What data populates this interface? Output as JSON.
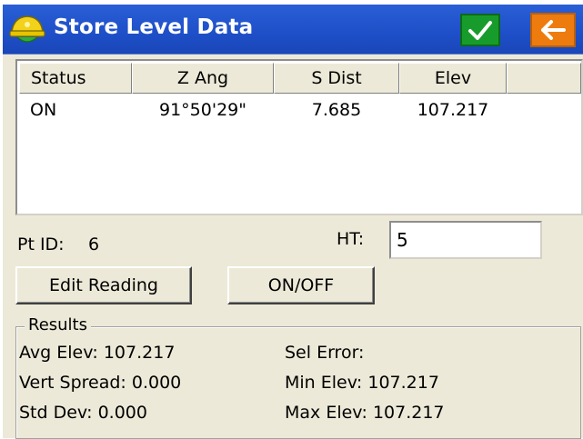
{
  "window": {
    "title": "Store Level Data"
  },
  "titlebar_icons": {
    "app": "hardhat-icon",
    "ok": "checkmark-icon",
    "back": "arrow-left-icon",
    "ok_color": "#179c2b",
    "back_color": "#ee7b0d"
  },
  "table": {
    "columns": [
      "Status",
      "Z Ang",
      "S Dist",
      "Elev",
      ""
    ],
    "rows": [
      [
        "ON",
        "91°50'29\"",
        "7.685",
        "107.217"
      ]
    ]
  },
  "point": {
    "label": "Pt ID:",
    "value": "6"
  },
  "ht": {
    "label": "HT:",
    "value": "5"
  },
  "buttons": {
    "edit_reading": "Edit Reading",
    "on_off": "ON/OFF"
  },
  "results": {
    "title": "Results",
    "avg_elev": "Avg Elev: 107.217",
    "vert_spread": "Vert Spread: 0.000",
    "std_dev": "Std Dev: 0.000",
    "sel_error": "Sel Error:",
    "min_elev": "Min Elev: 107.217",
    "max_elev": "Max Elev: 107.217"
  }
}
